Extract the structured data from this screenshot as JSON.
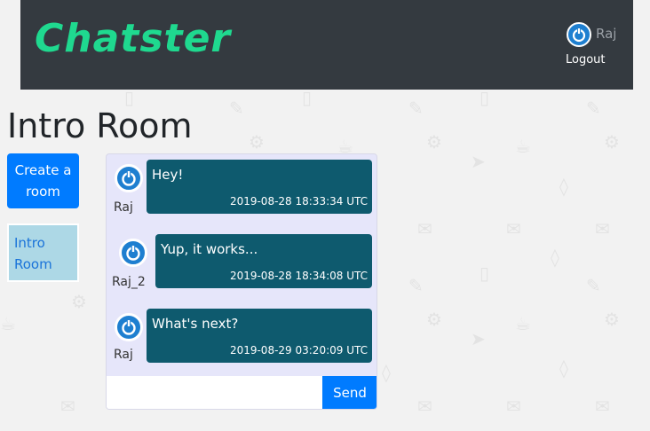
{
  "app": {
    "brand": "Chatster",
    "user_name": "Raj",
    "logout_label": "Logout",
    "accent_color": "#007bff",
    "brand_color": "#1fd98f"
  },
  "room": {
    "title": "Intro Room"
  },
  "sidebar": {
    "create_label": "Create a room",
    "rooms": [
      {
        "label": "Intro Room"
      }
    ]
  },
  "chat": {
    "messages": [
      {
        "author": "Raj",
        "text": "Hey!",
        "timestamp": "2019-08-28 18:33:34 UTC"
      },
      {
        "author": "Raj_2",
        "text": "Yup, it works...",
        "timestamp": "2019-08-28 18:34:08 UTC"
      },
      {
        "author": "Raj",
        "text": "What's next?",
        "timestamp": "2019-08-29 03:20:09 UTC"
      }
    ],
    "input_value": "",
    "input_placeholder": "",
    "send_label": "Send"
  }
}
